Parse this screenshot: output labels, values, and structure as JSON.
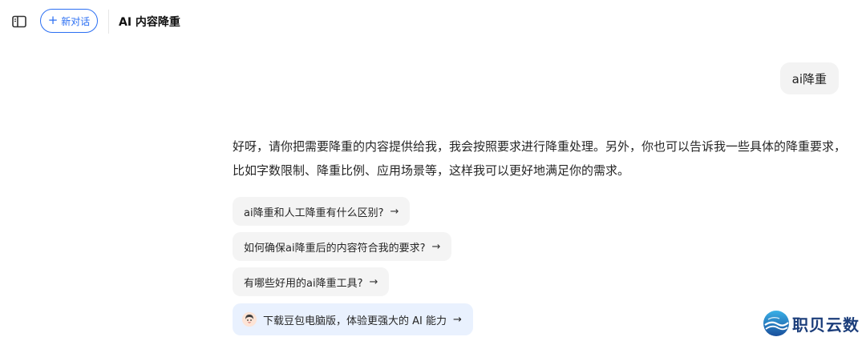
{
  "header": {
    "new_chat_label": "新对话",
    "title": "AI 内容降重"
  },
  "conversation": {
    "user_message": "ai降重",
    "assistant_message": "好呀，请你把需要降重的内容提供给我，我会按照要求进行降重处理。另外，你也可以告诉我一些具体的降重要求，比如字数限制、降重比例、应用场景等，这样我可以更好地满足你的需求。"
  },
  "suggestions": [
    {
      "label": "ai降重和人工降重有什么区别?"
    },
    {
      "label": "如何确保ai降重后的内容符合我的要求?"
    },
    {
      "label": "有哪些好用的ai降重工具?"
    }
  ],
  "promo": {
    "label": "下载豆包电脑版，体验更强大的 AI 能力"
  },
  "watermark": {
    "text": "职贝云数"
  },
  "icons": {
    "sidebar": "sidebar-toggle-icon",
    "plus": "plus-icon",
    "arrow": "arrow-right-icon",
    "avatar": "doubao-avatar-icon",
    "logo": "zhibei-logo-icon"
  },
  "colors": {
    "accent": "#2b6ff3",
    "bubble": "#f3f3f3",
    "suggestion": "#f4f4f4",
    "promo_bg": "#e9f1fe",
    "watermark": "#1b3d7a"
  }
}
